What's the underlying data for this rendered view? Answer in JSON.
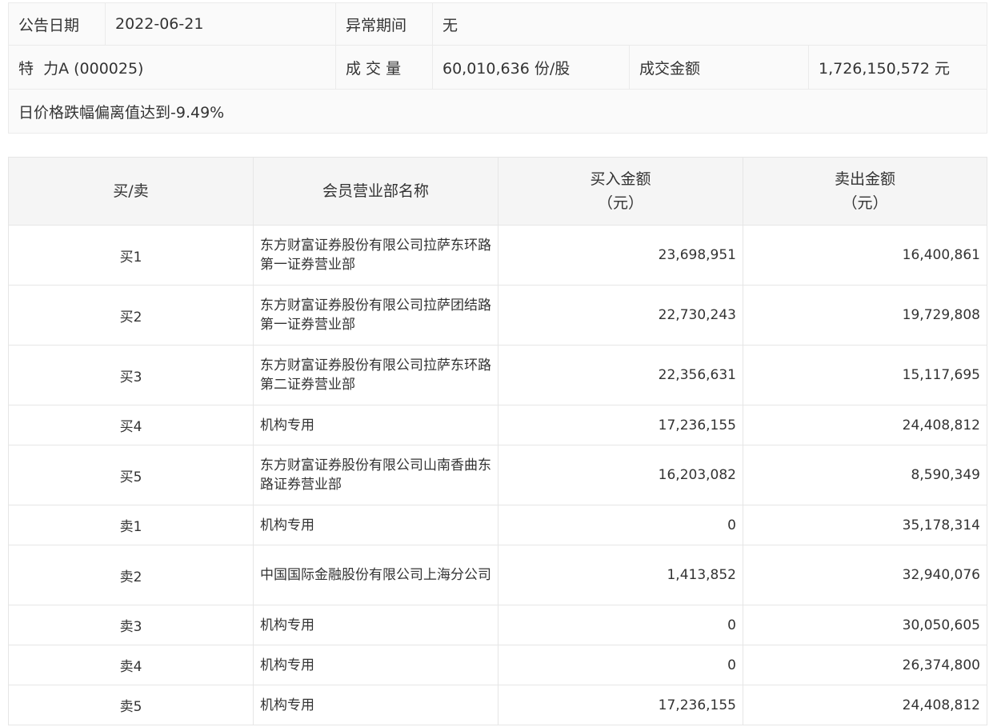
{
  "info": {
    "date_label": "公告日期",
    "date_value": "2022-06-21",
    "period_label": "异常期间",
    "period_value": "无",
    "stock_value": "特  力A (000025)",
    "volume_label": "成 交 量",
    "volume_value": "60,010,636 份/股",
    "amount_label": "成交金额",
    "amount_value": "1,726,150,572 元",
    "reason": "日价格跌幅偏离值达到-9.49%"
  },
  "trades": {
    "headers": {
      "side": "买/卖",
      "branch": "会员营业部名称",
      "buy_line1": "买入金额",
      "buy_line2": "（元）",
      "sell_line1": "卖出金额",
      "sell_line2": "（元）"
    },
    "rows": [
      {
        "rank": "买1",
        "branch": "东方财富证券股份有限公司拉萨东环路第一证券营业部",
        "buy": "23,698,951",
        "sell": "16,400,861"
      },
      {
        "rank": "买2",
        "branch": "东方财富证券股份有限公司拉萨团结路第一证券营业部",
        "buy": "22,730,243",
        "sell": "19,729,808"
      },
      {
        "rank": "买3",
        "branch": "东方财富证券股份有限公司拉萨东环路第二证券营业部",
        "buy": "22,356,631",
        "sell": "15,117,695"
      },
      {
        "rank": "买4",
        "branch": "机构专用",
        "buy": "17,236,155",
        "sell": "24,408,812"
      },
      {
        "rank": "买5",
        "branch": "东方财富证券股份有限公司山南香曲东路证券营业部",
        "buy": "16,203,082",
        "sell": "8,590,349"
      },
      {
        "rank": "卖1",
        "branch": "机构专用",
        "buy": "0",
        "sell": "35,178,314"
      },
      {
        "rank": "卖2",
        "branch": "中国国际金融股份有限公司上海分公司",
        "buy": "1,413,852",
        "sell": "32,940,076"
      },
      {
        "rank": "卖3",
        "branch": "机构专用",
        "buy": "0",
        "sell": "30,050,605"
      },
      {
        "rank": "卖4",
        "branch": "机构专用",
        "buy": "0",
        "sell": "26,374,800"
      },
      {
        "rank": "卖5",
        "branch": "机构专用",
        "buy": "17,236,155",
        "sell": "24,408,812"
      }
    ]
  }
}
